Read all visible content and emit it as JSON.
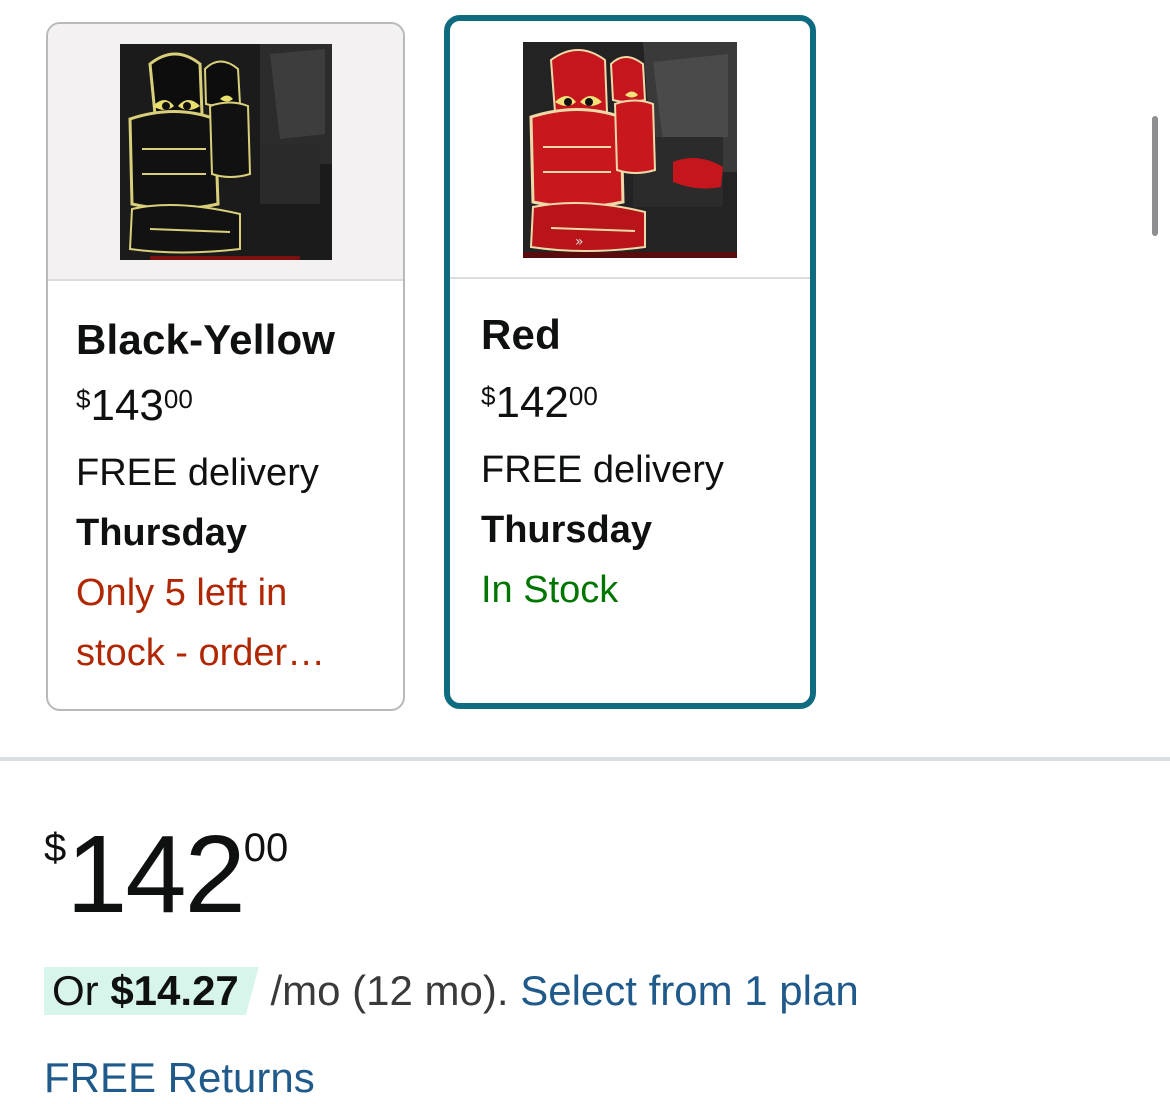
{
  "variants": [
    {
      "name": "Black-Yellow",
      "price_symbol": "$",
      "price_whole": "143",
      "price_fraction": "00",
      "delivery": "FREE delivery",
      "delivery_day": "Thursday",
      "stock_line1": "Only 5 left in",
      "stock_line2": "stock - order…",
      "stock_color": "#b12704",
      "image_icon": "black-yellow-car-seat-cover-image",
      "selected": false
    },
    {
      "name": "Red",
      "price_symbol": "$",
      "price_whole": "142",
      "price_fraction": "00",
      "delivery": "FREE delivery",
      "delivery_day": "Thursday",
      "stock_line1": "In Stock",
      "stock_color": "#007600",
      "image_icon": "red-car-seat-cover-image",
      "selected": true
    }
  ],
  "price": {
    "symbol": "$",
    "whole": "142",
    "fraction": "00"
  },
  "installment": {
    "or_label": "Or",
    "amount": "$14.27",
    "period": "/mo (12 mo).",
    "link": "Select from 1 plan"
  },
  "returns": "FREE Returns",
  "colors": {
    "selected_border": "#0f6b80",
    "link": "#1f5a8b",
    "badge_bg": "#d8f5ec",
    "low_stock": "#b12704",
    "in_stock": "#007600"
  }
}
